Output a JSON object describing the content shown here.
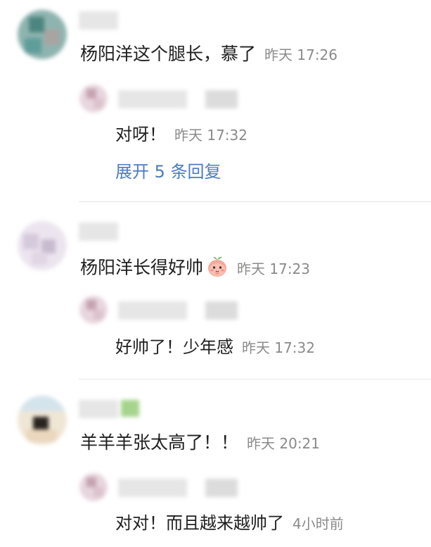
{
  "comments": [
    {
      "text": "杨阳洋这个腿长，慕了",
      "time": "昨天 17:26",
      "reply": {
        "text": "对呀！",
        "time": "昨天 17:32"
      },
      "expand_label": "展开 5 条回复"
    },
    {
      "text": "杨阳洋长得好帅",
      "emoji": "peach-emoji",
      "time": "昨天 17:23",
      "reply": {
        "text": "好帅了！少年感",
        "time": "昨天 17:32"
      }
    },
    {
      "text": "羊羊羊张太高了！！",
      "time": "昨天 20:21",
      "reply": {
        "text": "对对！而且越来越帅了",
        "time": "4小时前"
      }
    }
  ],
  "colors": {
    "link": "#4a7cbf",
    "timestamp": "#8a8a8a",
    "text": "#1f1f1f"
  }
}
